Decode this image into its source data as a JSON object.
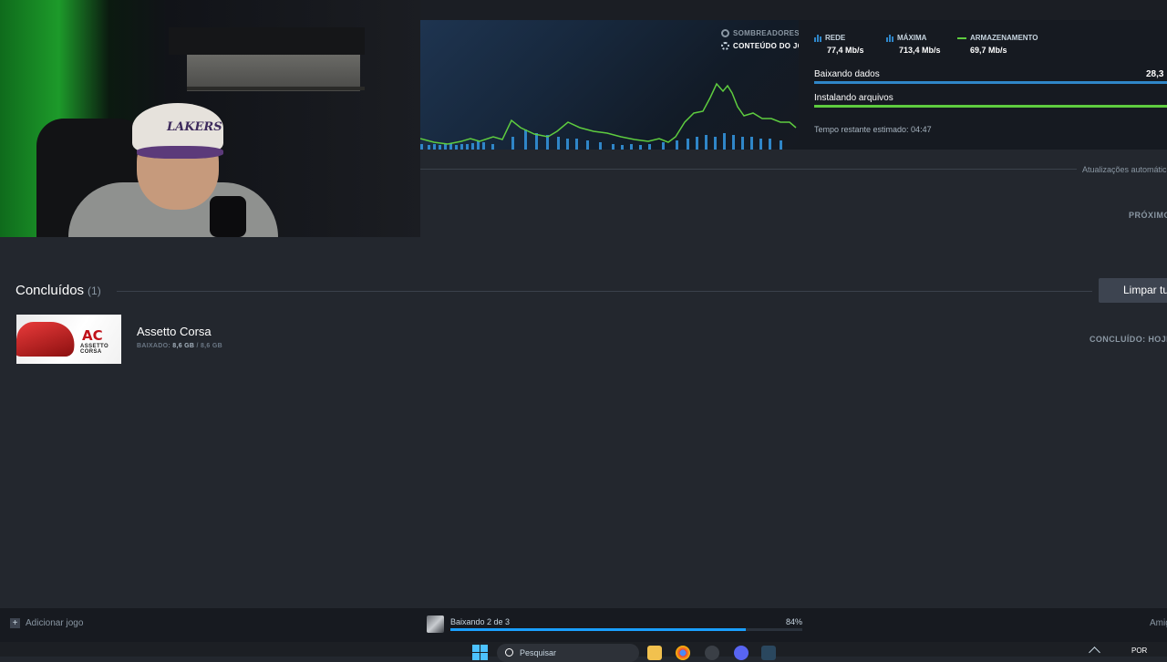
{
  "graph": {
    "legend": {
      "shaders": "SOMBREADORES",
      "game_content": "CONTEÚDO DO JOGO"
    },
    "stats": [
      {
        "label": "REDE",
        "value": "77,4 Mb/s"
      },
      {
        "label": "MÁXIMA",
        "value": "713,4 Mb/s"
      },
      {
        "label": "ARMAZENAMENTO",
        "value": "69,7 Mb/s"
      }
    ],
    "downloading_label": "Baixando dados",
    "downloading_value": "28,3",
    "installing_label": "Instalando arquivos",
    "eta": "Tempo restante estimado: 04:47",
    "colors": {
      "network": "#2f86c8",
      "storage": "#5ecc3f",
      "accent": "#1a9fff"
    }
  },
  "auto_updates_label": "Atualizações automátic",
  "next_label": "PRÓXIMO",
  "completed": {
    "title": "Concluídos",
    "count": "(1)",
    "clear_button": "Limpar tu",
    "items": [
      {
        "name": "Assetto Corsa",
        "size_prefix": "BAIXADO:",
        "size_done": "8,6 GB",
        "size_total": "/ 8,6 GB",
        "status": "CONCLUÍDO: HOJE",
        "thumb_logo": "AC",
        "thumb_text": "ASSETTO CORSA"
      }
    ]
  },
  "webcam": {
    "cap_text": "LAKERS"
  },
  "statusbar": {
    "add_game": "Adicionar jogo",
    "download_label": "Baixando 2 de 3",
    "download_percent": "84%",
    "download_progress": 0.84,
    "friends": "Amig"
  },
  "taskbar": {
    "search_placeholder": "Pesquisar",
    "language": "POR"
  }
}
